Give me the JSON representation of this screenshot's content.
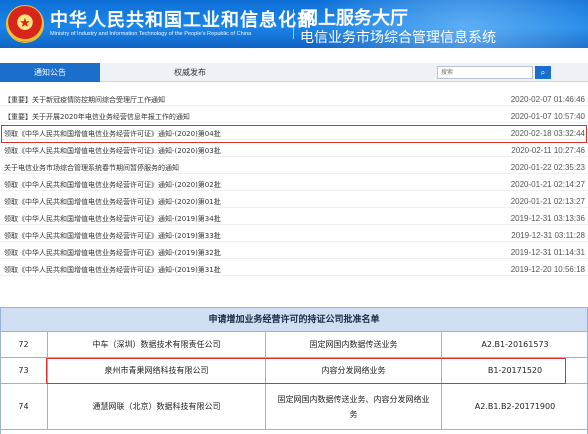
{
  "header": {
    "ministry_cn": "中华人民共和国工业和信息化部",
    "ministry_en": "Ministry of Industry and Information Technology of the People's Republic of China",
    "service_hall": "网上服务大厅",
    "system_name": "电信业务市场综合管理信息系统"
  },
  "tabs": [
    {
      "label": "通知公告",
      "active": true
    },
    {
      "label": "权威发布",
      "active": false
    }
  ],
  "search": {
    "placeholder": "搜索",
    "button_icon": "search-icon"
  },
  "notices": [
    {
      "title": "【重要】关于新冠疫情防控期间综合受理厅工作通知",
      "date": "2020-02-07 01:46:46"
    },
    {
      "title": "【重要】关于开展2020年电信业务经营信息年报工作的通知",
      "date": "2020-01-07 10:57:40"
    },
    {
      "title": "领取《中华人民共和国增值电信业务经营许可证》通知-(2020)第04批",
      "date": "2020-02-18 03:32:44",
      "highlighted": true
    },
    {
      "title": "领取《中华人民共和国增值电信业务经营许可证》通知-(2020)第03批",
      "date": "2020-02-11 10:27:46"
    },
    {
      "title": "关于电信业务市场综合管理系统春节期间暂停服务的通知",
      "date": "2020-01-22 02:35:23"
    },
    {
      "title": "领取《中华人民共和国增值电信业务经营许可证》通知-(2020)第02批",
      "date": "2020-01-21 02:14:27"
    },
    {
      "title": "领取《中华人民共和国增值电信业务经营许可证》通知-(2020)第01批",
      "date": "2020-01-21 02:13:27"
    },
    {
      "title": "领取《中华人民共和国增值电信业务经营许可证》通知-(2019)第34批",
      "date": "2019-12-31 03:13:36"
    },
    {
      "title": "领取《中华人民共和国增值电信业务经营许可证》通知-(2019)第33批",
      "date": "2019-12-31 03:11:28"
    },
    {
      "title": "领取《中华人民共和国增值电信业务经营许可证》通知-(2019)第32批",
      "date": "2019-12-31 01:14:31"
    },
    {
      "title": "领取《中华人民共和国增值电信业务经营许可证》通知-(2019)第31批",
      "date": "2019-12-20 10:56:18"
    }
  ],
  "table": {
    "title": "申请增加业务经营许可的持证公司批准名单",
    "rows": [
      {
        "no": "72",
        "company": "中车（深圳）数据技术有限责任公司",
        "business": "固定网国内数据传送业务",
        "license": "A2.B1-20161573"
      },
      {
        "no": "73",
        "company": "泉州市青果网络科技有限公司",
        "business": "内容分发网络业务",
        "license": "B1-20171520",
        "highlighted": true
      },
      {
        "no": "74",
        "company": "通慧网联（北京）数据科技有限公司",
        "business": "固定网国内数据传送业务、内容分发网络业务",
        "license": "A2.B1.B2-20171900"
      }
    ]
  },
  "colors": {
    "header_blue": "#1a86e8",
    "tab_active": "#1b6ec9",
    "highlight_red": "#d9342b",
    "table_head": "#cfdff1"
  }
}
